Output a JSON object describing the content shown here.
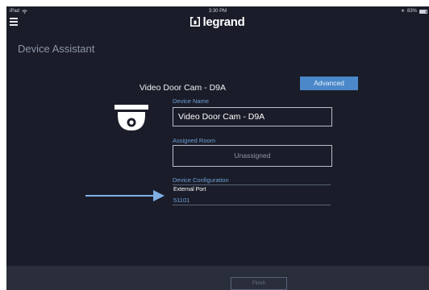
{
  "status_bar": {
    "device": "iPad",
    "time": "3:30 PM",
    "battery": "83%",
    "battery_level": 0.83
  },
  "header": {
    "logo_text": "legrand",
    "menu_icon": "hamburger-menu-icon"
  },
  "page": {
    "title": "Device Assistant"
  },
  "device": {
    "display_name": "Video Door Cam - D9A",
    "advanced_label": "Advanced",
    "icon": "dome-camera-icon"
  },
  "fields": {
    "device_name_label": "Device Name",
    "device_name_value": "Video Door Cam - D9A",
    "assigned_room_label": "Assigned Room",
    "assigned_room_value": "Unassigned",
    "config_label": "Device Configuration",
    "external_port_label": "External Port",
    "external_port_value": "51101"
  },
  "footer": {
    "finish_label": "Finish"
  },
  "colors": {
    "background": "#1a1d29",
    "accent": "#4a88c9",
    "label_blue": "#6f9fd6",
    "footer": "#2a2e3b"
  }
}
